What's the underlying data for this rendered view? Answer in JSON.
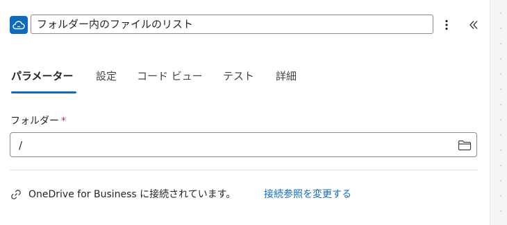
{
  "header": {
    "connector_icon": "onedrive-cloud-icon",
    "title": "フォルダー内のファイルのリスト",
    "more_icon": "more-vertical-icon",
    "collapse_icon": "double-chevron-left-icon"
  },
  "tabs": [
    {
      "label": "パラメーター",
      "active": true
    },
    {
      "label": "設定",
      "active": false
    },
    {
      "label": "コード ビュー",
      "active": false
    },
    {
      "label": "テスト",
      "active": false
    },
    {
      "label": "詳細",
      "active": false
    }
  ],
  "folder_field": {
    "label": "フォルダー",
    "required_mark": "*",
    "value": "/",
    "browse_icon": "folder-icon"
  },
  "connection": {
    "icon": "link-icon",
    "text": "OneDrive for Business に接続されています。",
    "change_link": "接続参照を変更する"
  },
  "colors": {
    "accent": "#0f6cbd",
    "required": "#c4314b",
    "text": "#242424"
  }
}
